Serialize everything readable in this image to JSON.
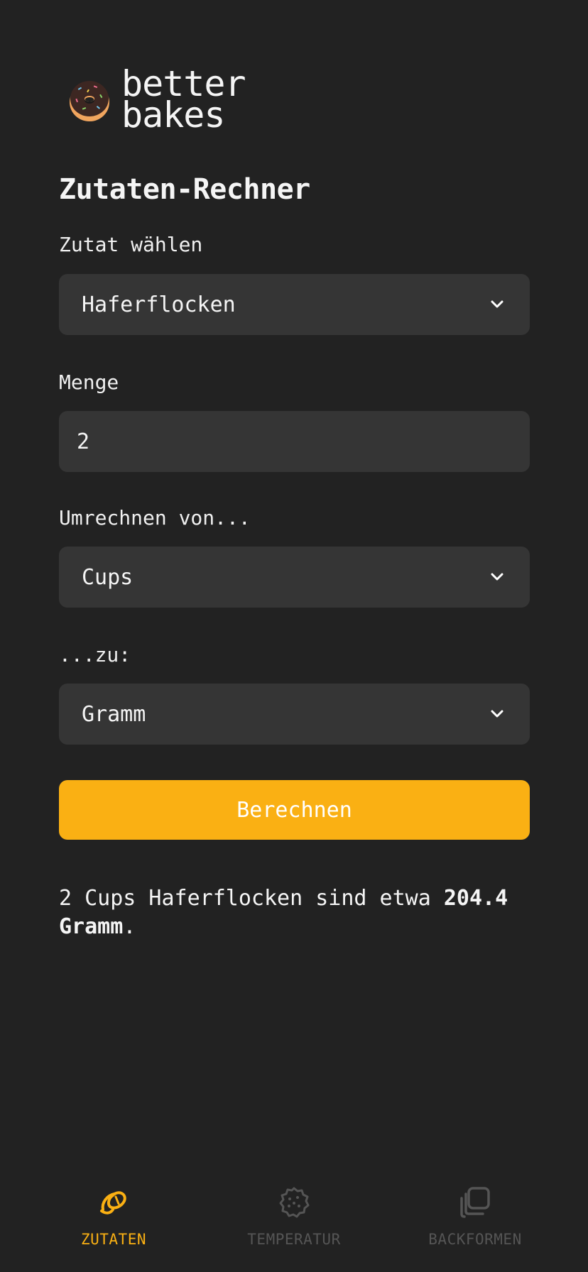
{
  "brand": {
    "logo_line1": "better",
    "logo_line2": "bakes",
    "icon": "donut-icon"
  },
  "page": {
    "title": "Zutaten-Rechner"
  },
  "form": {
    "ingredient": {
      "label": "Zutat wählen",
      "value": "Haferflocken"
    },
    "amount": {
      "label": "Menge",
      "value": "2"
    },
    "from_unit": {
      "label": "Umrechnen von...",
      "value": "Cups"
    },
    "to_unit": {
      "label": "...zu:",
      "value": "Gramm"
    },
    "submit_label": "Berechnen"
  },
  "result": {
    "prefix": "2 Cups Haferflocken sind etwa ",
    "amount_bold": "204.4 Gramm",
    "suffix": "."
  },
  "nav": {
    "items": [
      {
        "label": "ZUTATEN",
        "icon": "croissant-icon",
        "active": true
      },
      {
        "label": "TEMPERATUR",
        "icon": "cookie-icon",
        "active": false
      },
      {
        "label": "BACKFORMEN",
        "icon": "baking-pans-icon",
        "active": false
      }
    ]
  },
  "colors": {
    "background": "#222222",
    "field": "#353535",
    "accent": "#fab013",
    "inactive_nav": "#555555"
  }
}
